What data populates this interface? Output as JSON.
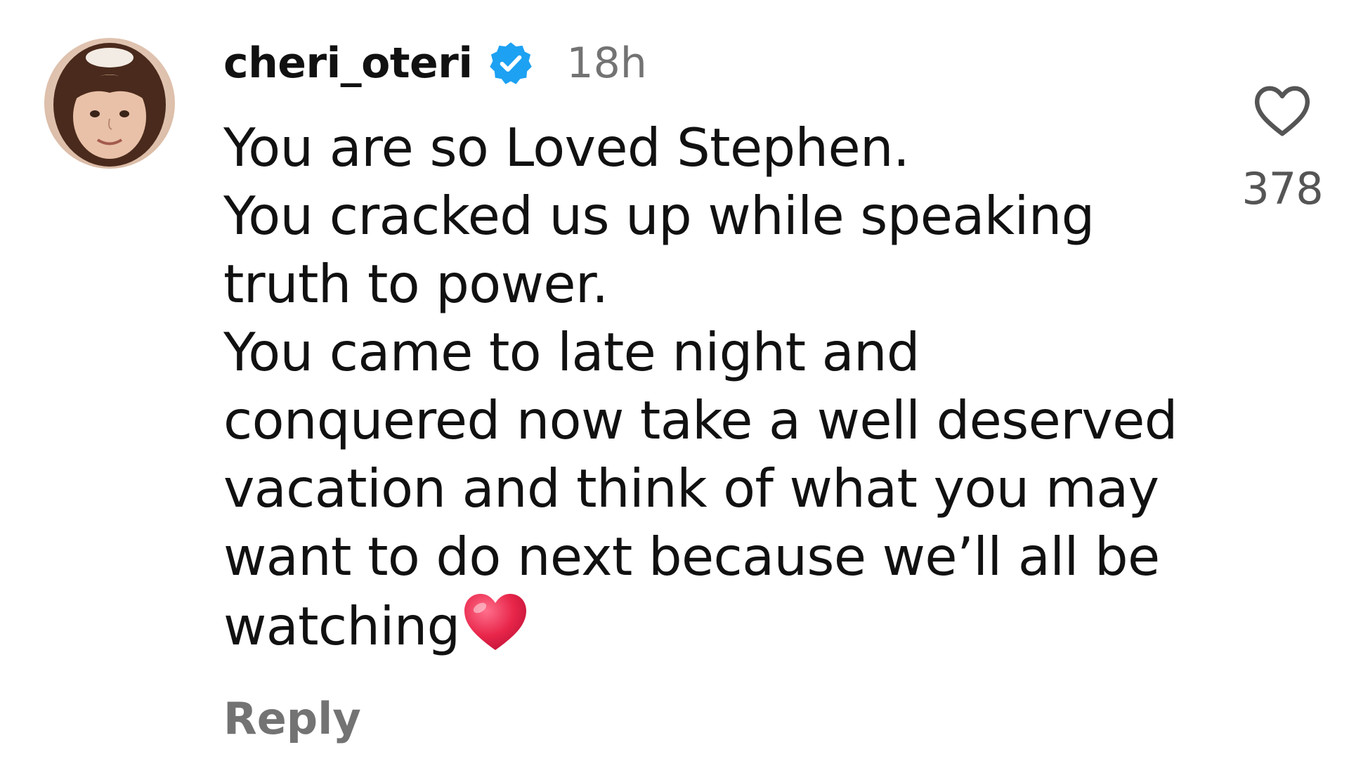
{
  "comment": {
    "username": "cheri_oteri",
    "verified_icon": "verified-badge-icon",
    "timestamp": "18h",
    "lines": [
      "You are so Loved Stephen.",
      "You cracked us up while speaking",
      "truth to power.",
      "You came to late night and",
      "conquered now take a well deserved",
      "vacation and think of what you may",
      "want to do next because we’ll all be",
      "watching"
    ],
    "trailing_emoji": "❤️",
    "reply_label": "Reply"
  },
  "like": {
    "icon": "heart-outline-icon",
    "count": "378"
  },
  "colors": {
    "verified_blue": "#1da1f2",
    "muted_text": "#737373",
    "emoji_red": "#e8264a"
  }
}
